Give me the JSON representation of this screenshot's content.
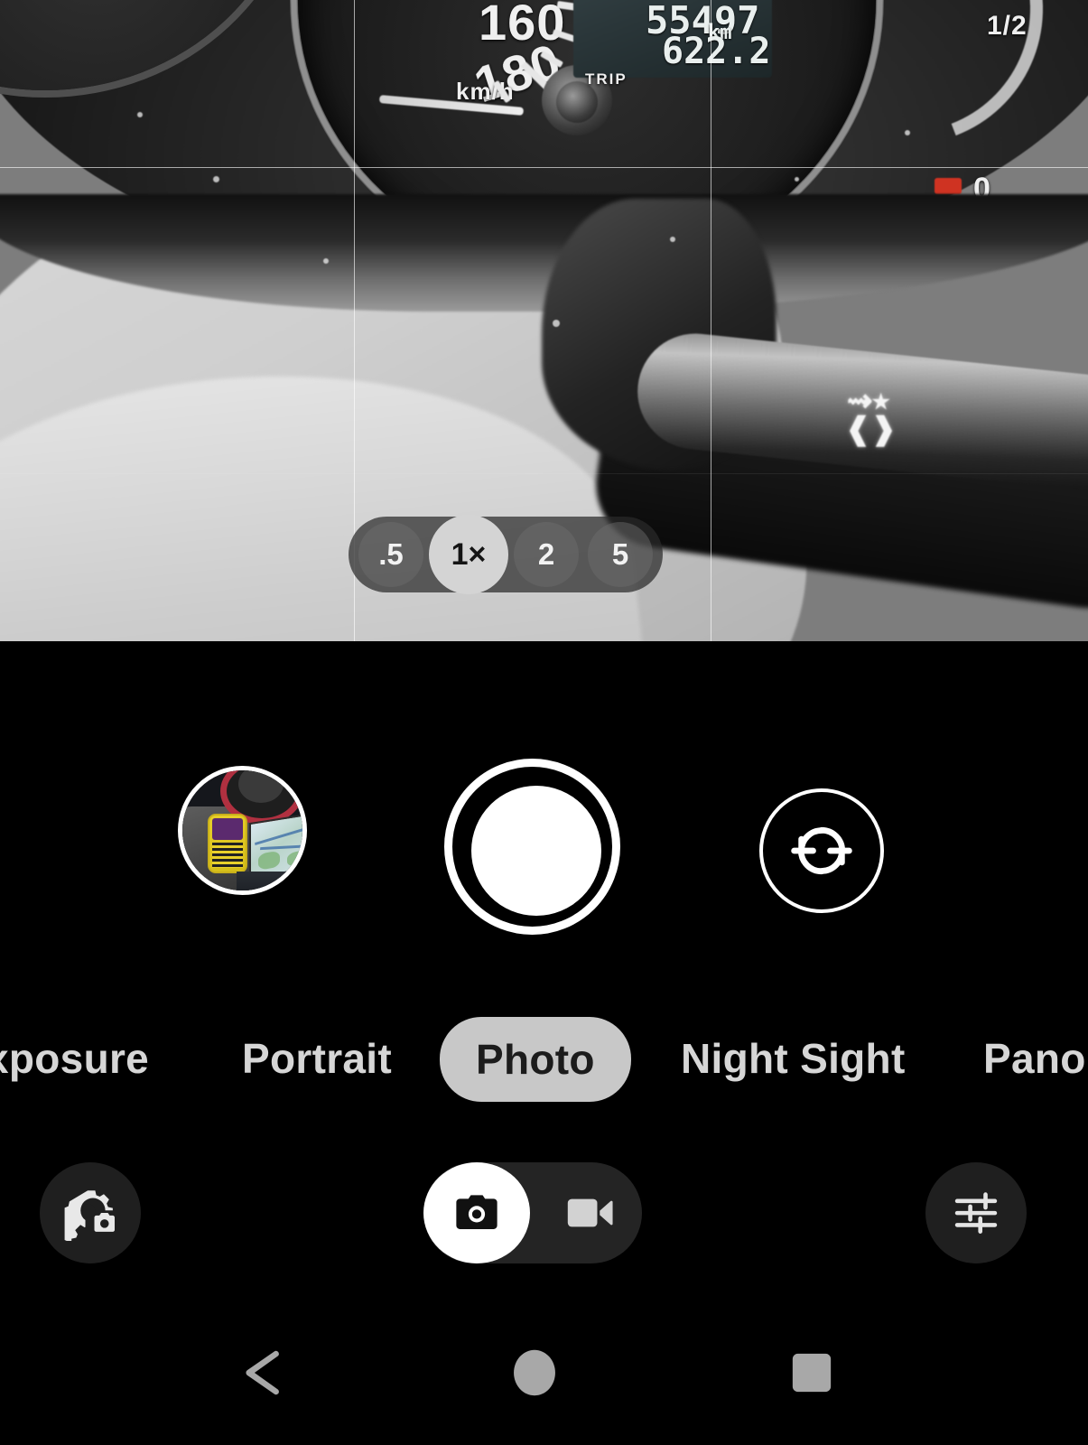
{
  "app": {
    "name": "Camera",
    "accent_color": "#ffffff",
    "background_color": "#000000",
    "selected_pill_color": "#c8c8c8"
  },
  "viewfinder": {
    "grid_enabled": true,
    "grid_name": "3x3-grid",
    "scene_description": "car dashboard instrument cluster and turn signal stalk",
    "dashboard": {
      "speed_marks": [
        "160",
        "180"
      ],
      "speed_unit": "km/h",
      "odometer": "55497",
      "odometer_unit": "km",
      "trip_value": "622.2",
      "trip_label": "TRIP",
      "fuel_half_label": "1/2",
      "fuel_empty_label": "0"
    }
  },
  "zoom_control": {
    "name": "zoom-level-selector",
    "selected": "1×",
    "options": [
      {
        "label": ".5",
        "value": "0.5",
        "selected": false
      },
      {
        "label": "1×",
        "value": "1",
        "selected": true
      },
      {
        "label": "2",
        "value": "2",
        "selected": false
      },
      {
        "label": "5",
        "value": "5",
        "selected": false
      }
    ]
  },
  "capture": {
    "thumbnail_label": "last-photo-thumbnail",
    "thumbnail_description": "car interior with yellow GPS device and navigation map screen",
    "shutter_label": "shutter-button",
    "flip_label": "flip-camera-button",
    "flip_icon": "camera-flip-icon"
  },
  "modes": {
    "selected": "Photo",
    "items": [
      {
        "label": "xposure",
        "full_label": "Long Exposure",
        "selected": false,
        "clipped": true
      },
      {
        "label": "Portrait",
        "selected": false,
        "clipped": false
      },
      {
        "label": "Photo",
        "selected": true,
        "clipped": false
      },
      {
        "label": "Night Sight",
        "selected": false,
        "clipped": false
      },
      {
        "label": "Pano",
        "full_label": "Panorama",
        "selected": false,
        "clipped": true
      }
    ]
  },
  "bottom_bar": {
    "settings_icon": "camera-settings-gear-icon",
    "tune_icon": "tune-sliders-icon",
    "media_toggle": {
      "selected": "photo",
      "photo_icon": "camera-icon",
      "video_icon": "video-camera-icon"
    }
  },
  "nav_bar": {
    "back_icon": "back-triangle-icon",
    "home_icon": "home-circle-icon",
    "recents_icon": "recents-square-icon",
    "icon_color": "#a8a8a8"
  }
}
